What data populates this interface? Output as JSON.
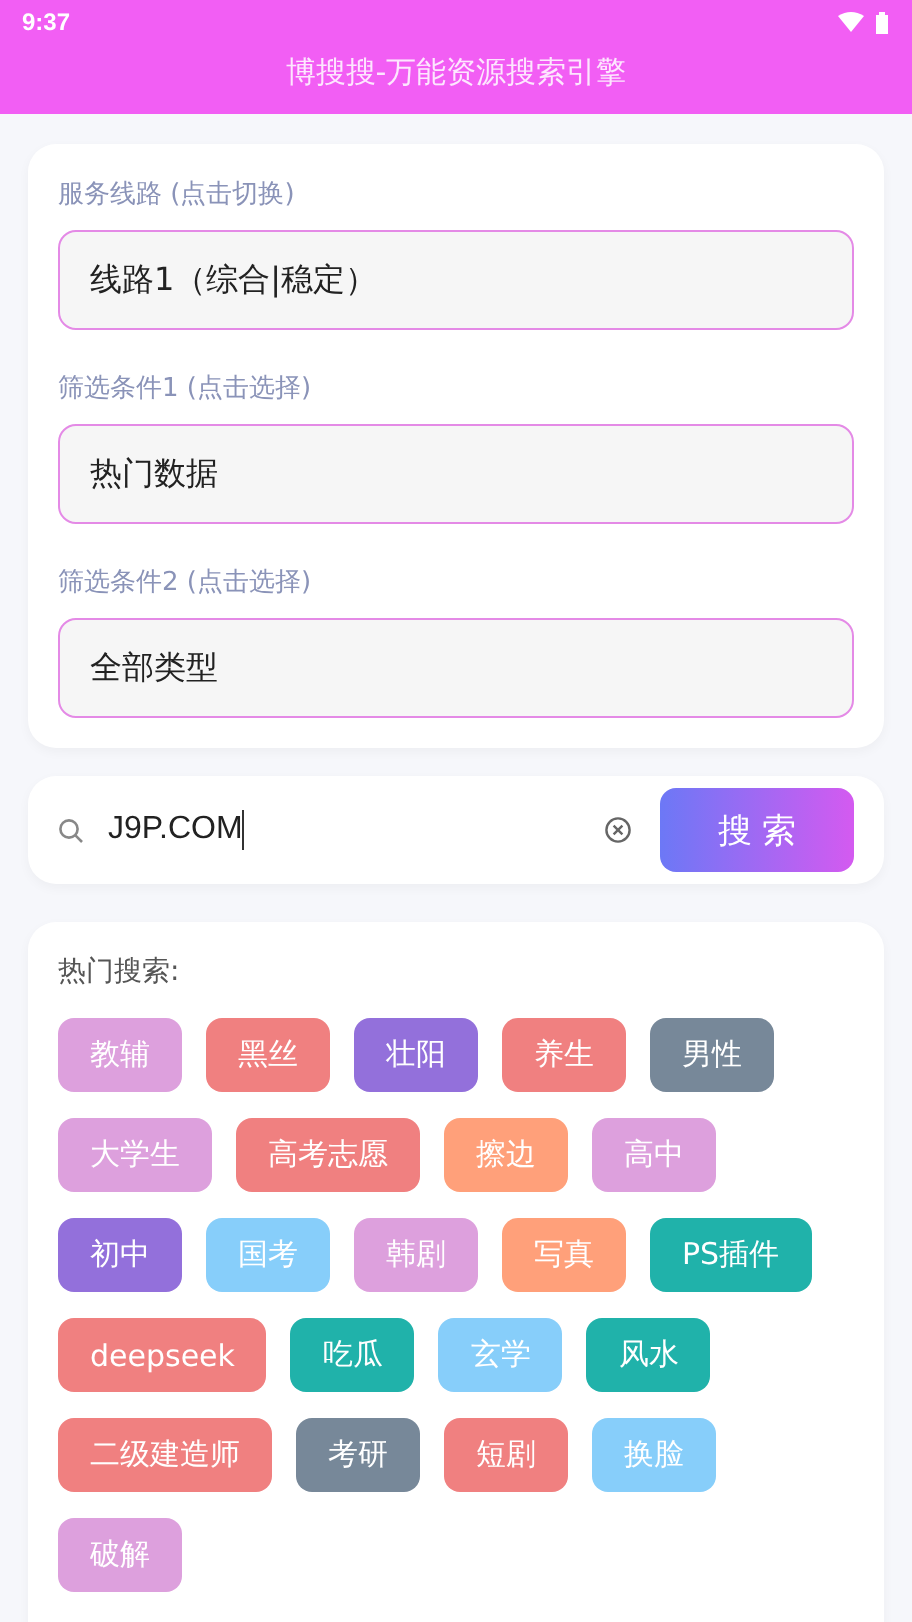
{
  "status_bar": {
    "time": "9:37"
  },
  "header": {
    "title": "博搜搜-万能资源搜索引擎"
  },
  "filters": [
    {
      "label": "服务线路 (点击切换)",
      "value": "线路1（综合|稳定）"
    },
    {
      "label": "筛选条件1 (点击选择)",
      "value": "热门数据"
    },
    {
      "label": "筛选条件2 (点击选择)",
      "value": "全部类型"
    }
  ],
  "search": {
    "value": "J9P.COM",
    "button": "搜 索"
  },
  "hot": {
    "title": "热门搜索:",
    "tags": [
      {
        "label": "教辅",
        "color": "#dda0dd"
      },
      {
        "label": "黑丝",
        "color": "#f08080"
      },
      {
        "label": "壮阳",
        "color": "#9370db"
      },
      {
        "label": "养生",
        "color": "#f08080"
      },
      {
        "label": "男性",
        "color": "#778899"
      },
      {
        "label": "大学生",
        "color": "#dda0dd"
      },
      {
        "label": "高考志愿",
        "color": "#f08080"
      },
      {
        "label": "擦边",
        "color": "#ffa07a"
      },
      {
        "label": "高中",
        "color": "#dda0dd"
      },
      {
        "label": "初中",
        "color": "#9370db"
      },
      {
        "label": "国考",
        "color": "#87cefa"
      },
      {
        "label": "韩剧",
        "color": "#dda0dd"
      },
      {
        "label": "写真",
        "color": "#ffa07a"
      },
      {
        "label": "PS插件",
        "color": "#20b2aa"
      },
      {
        "label": "deepseek",
        "color": "#f08080"
      },
      {
        "label": "吃瓜",
        "color": "#20b2aa"
      },
      {
        "label": "玄学",
        "color": "#87cefa"
      },
      {
        "label": "风水",
        "color": "#20b2aa"
      },
      {
        "label": "二级建造师",
        "color": "#f08080"
      },
      {
        "label": "考研",
        "color": "#778899"
      },
      {
        "label": "短剧",
        "color": "#f08080"
      },
      {
        "label": "换脸",
        "color": "#87cefa"
      },
      {
        "label": "破解",
        "color": "#dda0dd"
      }
    ]
  }
}
